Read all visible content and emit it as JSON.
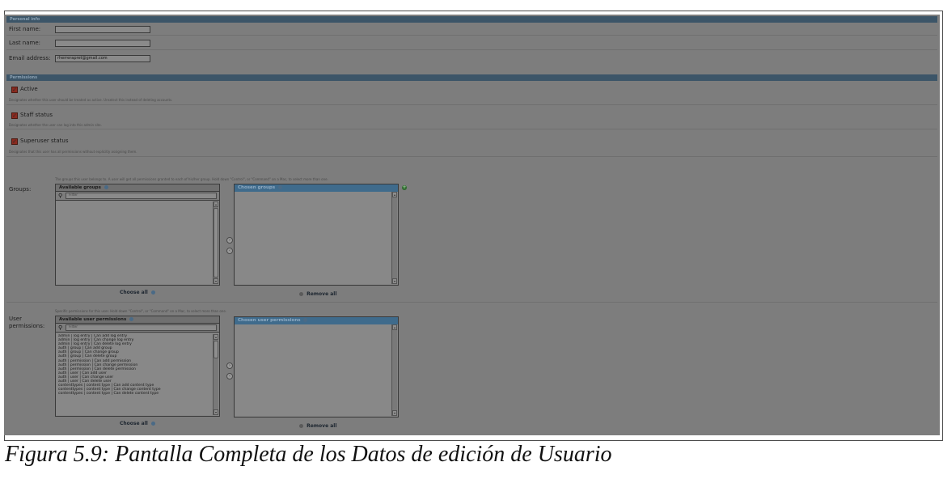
{
  "personal_info": {
    "header": "Personal info",
    "first_name_label": "First name:",
    "first_name_value": "",
    "last_name_label": "Last name:",
    "last_name_value": "",
    "email_label": "Email address:",
    "email_value": "rherrerapret@gmail.com"
  },
  "permissions": {
    "header": "Permissions",
    "active_label": "Active",
    "active_help": "Designates whether this user should be treated as active. Unselect this instead of deleting accounts.",
    "staff_label": "Staff status",
    "staff_help": "Designates whether the user can log into this admin site.",
    "superuser_label": "Superuser status",
    "superuser_help": "Designates that this user has all permissions without explicitly assigning them."
  },
  "groups": {
    "label": "Groups:",
    "help": "The groups this user belongs to. A user will get all permissions granted to each of his/her group. Hold down \"Control\", or \"Command\" on a Mac, to select more than one.",
    "available_title": "Available groups",
    "filter_placeholder": "Filter",
    "chosen_title": "Chosen groups",
    "choose_all": "Choose all",
    "remove_all": "Remove all"
  },
  "user_permissions": {
    "label": "User permissions:",
    "help": "Specific permissions for this user. Hold down \"Control\", or \"Command\" on a Mac, to select more than one.",
    "available_title": "Available user permissions",
    "filter_placeholder": "Filter",
    "chosen_title": "Chosen user permissions",
    "choose_all": "Choose all",
    "remove_all": "Remove all",
    "items": [
      "admin | log entry | Can add log entry",
      "admin | log entry | Can change log entry",
      "admin | log entry | Can delete log entry",
      "auth | group | Can add group",
      "auth | group | Can change group",
      "auth | group | Can delete group",
      "auth | permission | Can add permission",
      "auth | permission | Can change permission",
      "auth | permission | Can delete permission",
      "auth | user | Can add user",
      "auth | user | Can change user",
      "auth | user | Can delete user",
      "contenttypes | content type | Can add content type",
      "contenttypes | content type | Can change content type",
      "contenttypes | content type | Can delete content type"
    ]
  },
  "icons": {
    "help": "help-circle-icon",
    "filter": "magnifier-icon",
    "move_right": "arrow-right-icon",
    "move_left": "arrow-left-icon",
    "add": "plus-icon"
  },
  "caption": "Figura 5.9: Pantalla Completa de los Datos de edición de Usuario"
}
